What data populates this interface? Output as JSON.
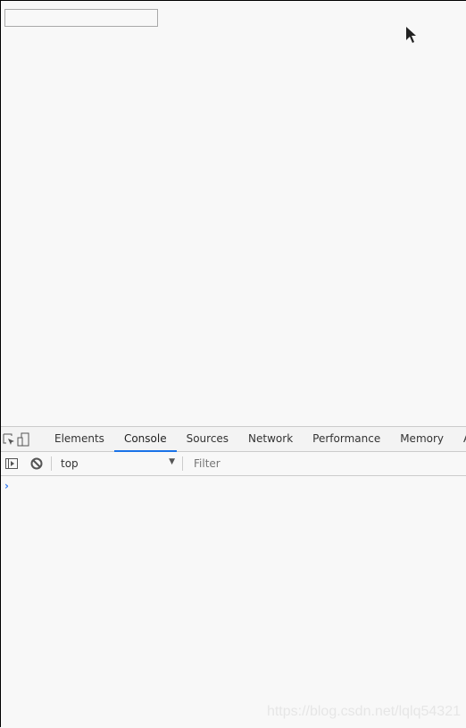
{
  "page": {
    "input_value": ""
  },
  "devtools": {
    "tabs": [
      {
        "label": "Elements"
      },
      {
        "label": "Console",
        "active": true
      },
      {
        "label": "Sources"
      },
      {
        "label": "Network"
      },
      {
        "label": "Performance"
      },
      {
        "label": "Memory"
      },
      {
        "label": "Ap"
      }
    ],
    "console": {
      "context": "top",
      "filter_placeholder": "Filter",
      "prompt": "›"
    },
    "accent": "#1a73e8"
  },
  "watermark": "https://blog.csdn.net/lqlq54321"
}
